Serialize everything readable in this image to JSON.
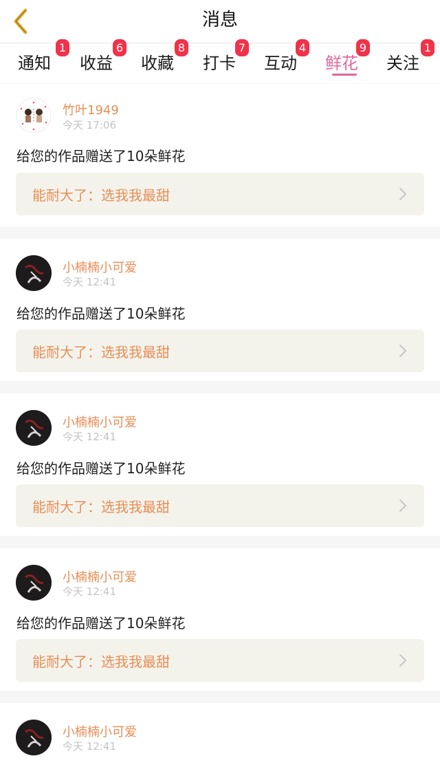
{
  "header": {
    "title": "消息",
    "back_icon": "chevron-left-icon",
    "back_color": "#e8b23a"
  },
  "tabs": [
    {
      "label": "通知",
      "badge": "1",
      "active": false
    },
    {
      "label": "收益",
      "badge": "6",
      "active": false
    },
    {
      "label": "收藏",
      "badge": "8",
      "active": false
    },
    {
      "label": "打卡",
      "badge": "7",
      "active": false
    },
    {
      "label": "互动",
      "badge": "4",
      "active": false
    },
    {
      "label": "鲜花",
      "badge": "9",
      "active": true
    },
    {
      "label": "关注",
      "badge": "1",
      "active": false
    }
  ],
  "colors": {
    "accent": "#e0679b",
    "badge": "#f0324a",
    "name": "#e88e56",
    "work_bg": "#f3f3ec"
  },
  "feed": [
    {
      "user": "竹叶1949",
      "time": "今天 17:06",
      "message": "给您的作品赠送了10朵鲜花",
      "work_title": "能耐大了：选我我最甜",
      "avatar": "couple-cartoon-avatar"
    },
    {
      "user": "小楠楠小可爱",
      "time": "今天 12:41",
      "message": "给您的作品赠送了10朵鲜花",
      "work_title": "能耐大了：选我我最甜",
      "avatar": "dark-calligraphy-avatar"
    },
    {
      "user": "小楠楠小可爱",
      "time": "今天 12:41",
      "message": "给您的作品赠送了10朵鲜花",
      "work_title": "能耐大了：选我我最甜",
      "avatar": "dark-calligraphy-avatar"
    },
    {
      "user": "小楠楠小可爱",
      "time": "今天 12:41",
      "message": "给您的作品赠送了10朵鲜花",
      "work_title": "能耐大了：选我我最甜",
      "avatar": "dark-calligraphy-avatar"
    },
    {
      "user": "小楠楠小可爱",
      "time": "今天 12:41",
      "message": "",
      "work_title": "",
      "avatar": "dark-calligraphy-avatar"
    }
  ]
}
